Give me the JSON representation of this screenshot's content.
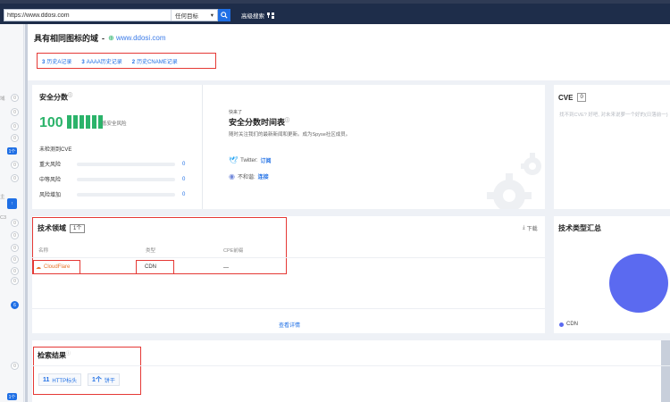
{
  "search": {
    "value": "https://www.ddosi.com",
    "target_label": "任何目标",
    "advanced_label": "高级搜索"
  },
  "left_strip": {
    "labels": [
      "域",
      "主",
      "C3"
    ],
    "counts": [
      "0",
      "0",
      "0",
      "0",
      "0",
      "1个",
      "0",
      "0",
      "0",
      "0",
      "0",
      "0",
      "0",
      "0",
      "0",
      "6",
      "0",
      "1个"
    ]
  },
  "header": {
    "title": "具有相同图标的域",
    "separator": "-",
    "domain": "www.ddosi.com"
  },
  "history_tabs": [
    {
      "count": "3",
      "label": "历史A记录"
    },
    {
      "count": "3",
      "label": "AAAA历史记录"
    },
    {
      "count": "2",
      "label": "历史CNAME记录"
    }
  ],
  "score": {
    "title": "安全分数",
    "value": "100",
    "level": "低安全风险",
    "cve_label": "未检测到CVE",
    "risks": [
      {
        "name": "重大风险",
        "value": "0"
      },
      {
        "name": "中等风险",
        "value": "0"
      },
      {
        "name": "风险增加",
        "value": "0"
      }
    ]
  },
  "promo": {
    "small": "快来了",
    "title": "安全分数时间表",
    "desc": "随时关注我们的最新新闻和更新。成为Spyse社区成员。",
    "twitter_label": "Twitter:",
    "twitter_action": "订阅",
    "discord_label": "不和谐:",
    "discord_action": "连接"
  },
  "cve": {
    "title": "CVE",
    "count": "0",
    "empty_text": "找不到CVE? 好吧, 对未来说萝一个好的(日落前一)"
  },
  "tech": {
    "title": "技术领域",
    "count": "1个",
    "download": "下载",
    "columns": [
      "名称",
      "类型",
      "CPE前缀"
    ],
    "rows": [
      {
        "name": "CloudFlare",
        "type": "CDN",
        "cpe": "—"
      }
    ],
    "more": "查看详情"
  },
  "summary": {
    "title": "技术类型汇总",
    "legend": "CDN",
    "color": "#5b6af0"
  },
  "results": {
    "title": "检索结果",
    "chips": [
      {
        "count": "11",
        "label": "HTTP标头"
      },
      {
        "count": "1个",
        "label": "饼干"
      }
    ]
  },
  "colors": {
    "topbar": "#1e2d4a",
    "accent": "#1f6fe5",
    "success": "#2bb36a",
    "highlight": "#e53935"
  }
}
